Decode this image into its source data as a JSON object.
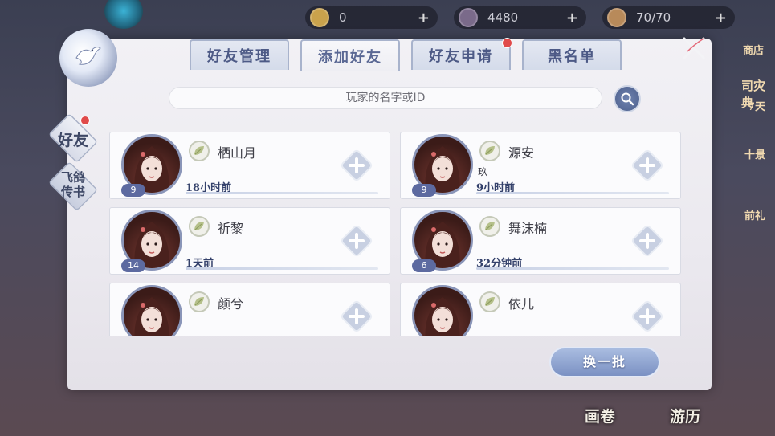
{
  "top_resources": [
    {
      "icon": "jade-coin-icon",
      "value": "0"
    },
    {
      "icon": "silver-coin-icon",
      "value": "4480"
    },
    {
      "icon": "stamina-bowl-icon",
      "value": "70/70"
    }
  ],
  "right_side_labels": [
    "商店",
    "司灾典",
    "7天",
    "十景",
    "前礼"
  ],
  "bottom_labels": [
    "画卷",
    "游历"
  ],
  "tabs": [
    {
      "label": "好友管理",
      "active": false,
      "badge": false
    },
    {
      "label": "添加好友",
      "active": true,
      "badge": false
    },
    {
      "label": "好友申请",
      "active": false,
      "badge": true
    },
    {
      "label": "黑名单",
      "active": false,
      "badge": false
    }
  ],
  "side_tabs": [
    {
      "label": "好友",
      "badge": true
    },
    {
      "label": "飞鸽\n传书",
      "badge": false
    }
  ],
  "search": {
    "placeholder": "玩家的名字或ID"
  },
  "players": [
    {
      "name": "栖山月",
      "level": "9",
      "sub": "",
      "last_online": "18小时前"
    },
    {
      "name": "源安",
      "level": "9",
      "sub": "玖",
      "last_online": "9小时前"
    },
    {
      "name": "祈黎",
      "level": "14",
      "sub": "",
      "last_online": "1天前"
    },
    {
      "name": "舞沫楠",
      "level": "6",
      "sub": "",
      "last_online": "32分钟前"
    },
    {
      "name": "颜兮",
      "level": "",
      "sub": "",
      "last_online": ""
    },
    {
      "name": "依儿",
      "level": "",
      "sub": "",
      "last_online": ""
    }
  ],
  "refresh_label": "换一批",
  "colors": {
    "accent": "#5d6aa0",
    "badge": "#e04a4a",
    "panel": "#f2f1f5"
  }
}
